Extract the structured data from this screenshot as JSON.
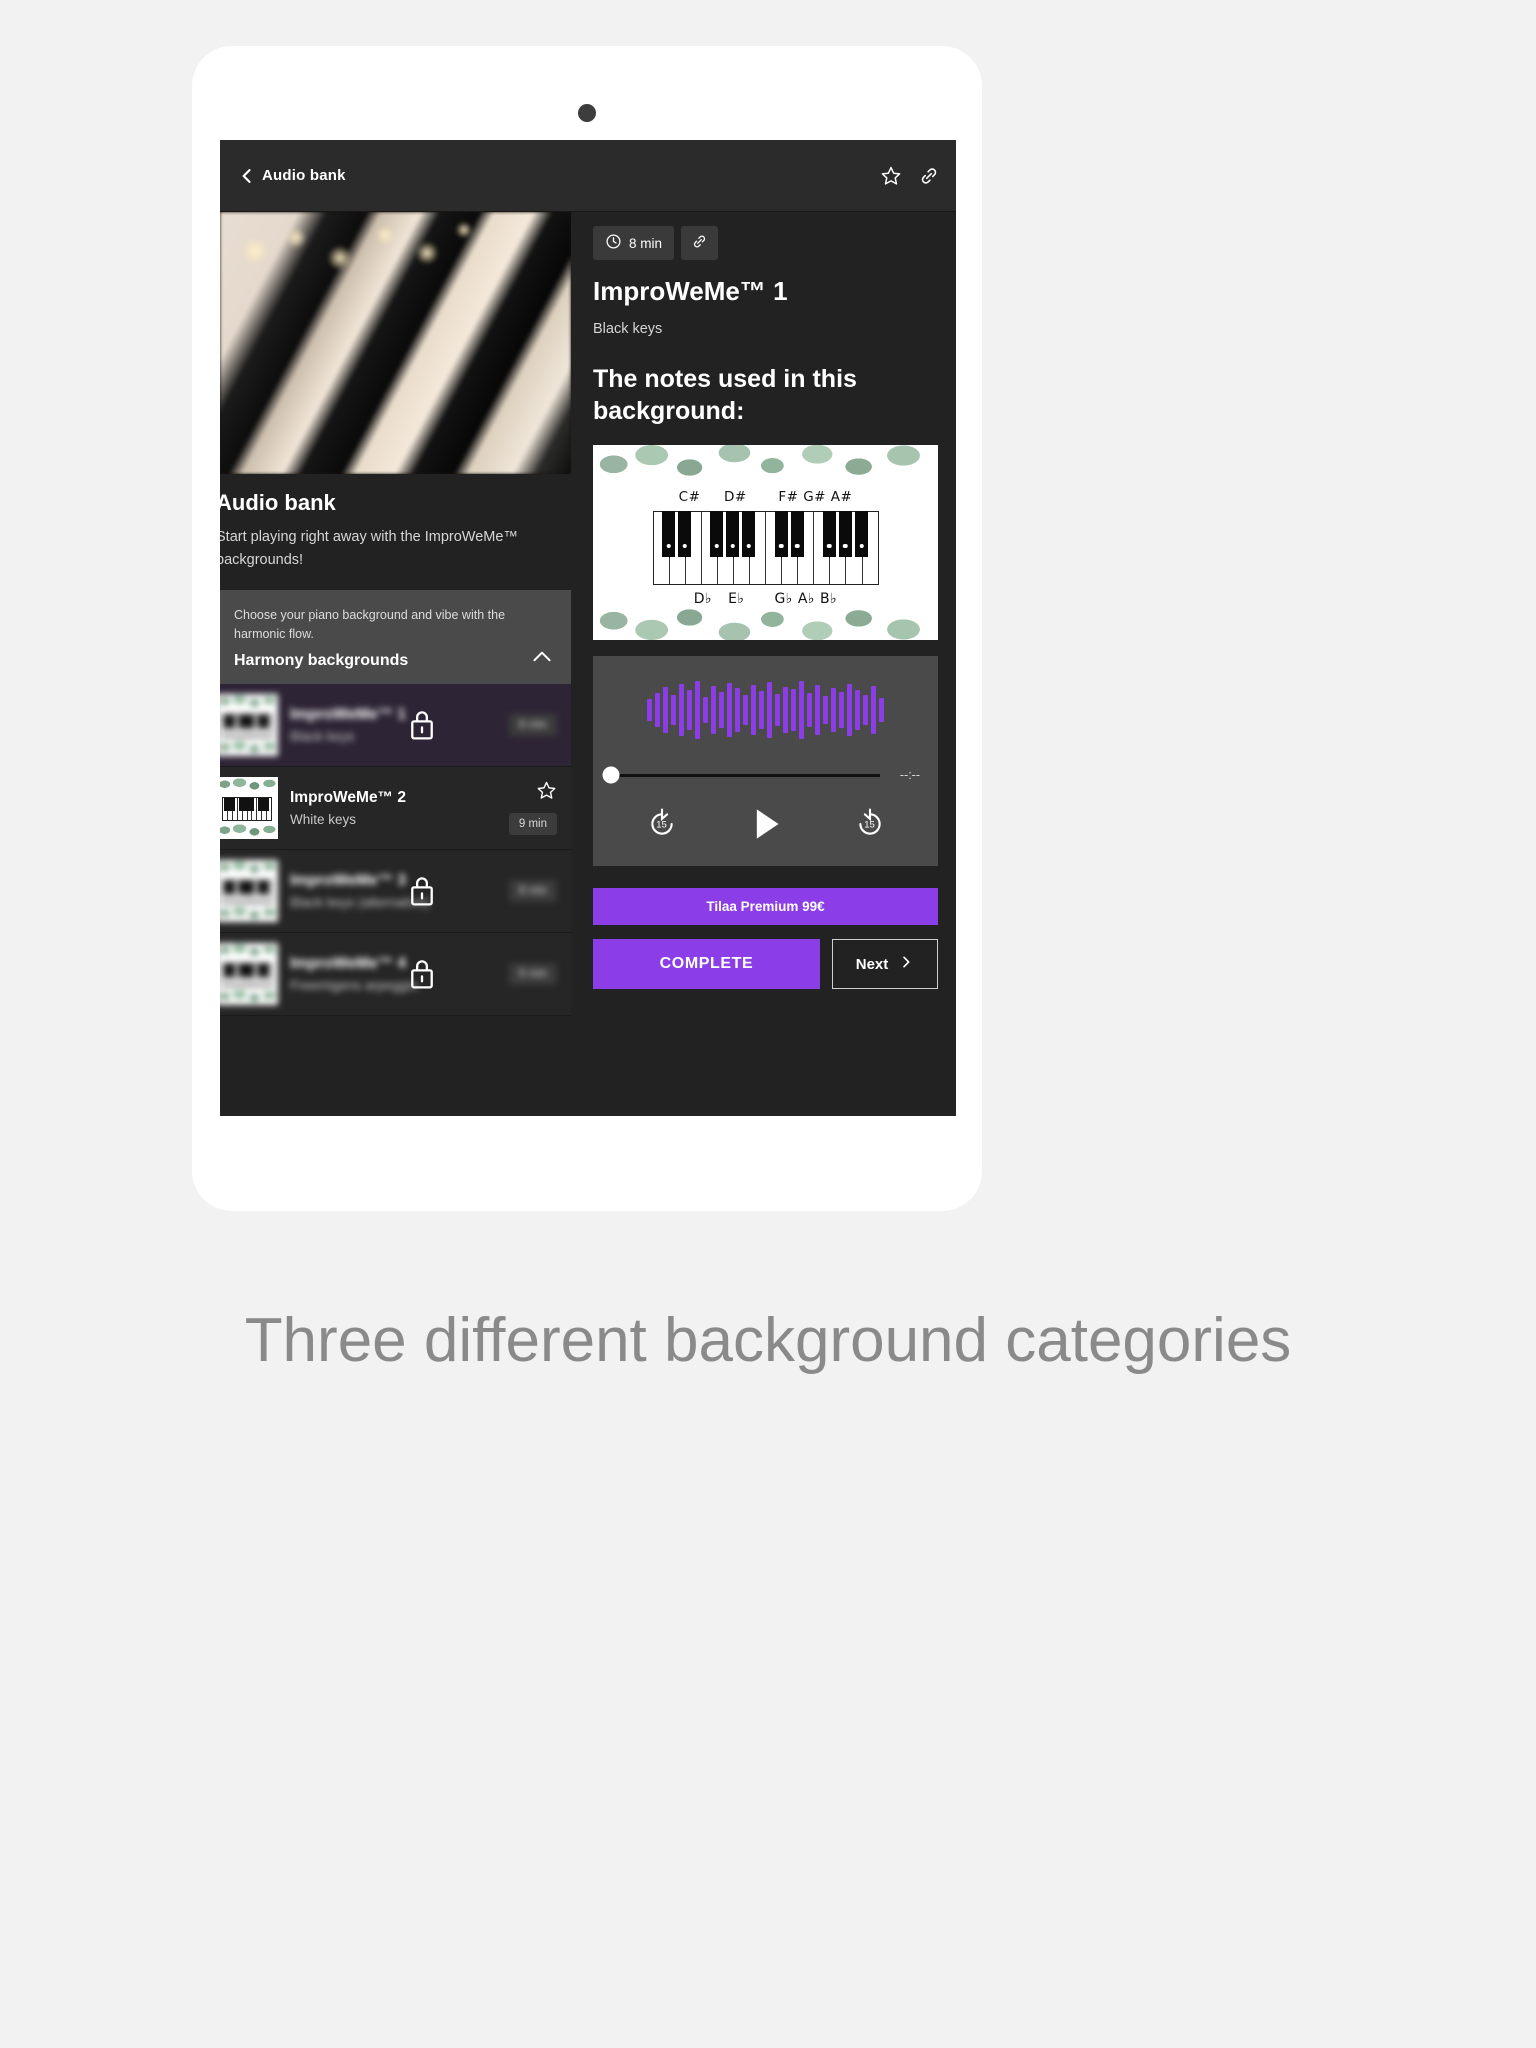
{
  "appbar": {
    "title": "Audio bank",
    "back_icon": "chevron-left-icon",
    "favorite_icon": "star-outline-icon",
    "link_icon": "link-icon"
  },
  "left_panel": {
    "hero_alt": "piano-keys-photo",
    "title": "Audio bank",
    "description": "Start playing right away with the ImproWeMe™ backgrounds!",
    "accordion": {
      "subtitle": "Choose your piano background and vibe with the harmonic flow.",
      "title": "Harmony backgrounds",
      "chevron_icon": "chevron-up-icon"
    },
    "tracks": [
      {
        "title": "ImproWeMe™ 1",
        "subtitle": "Black keys",
        "duration": "8 min",
        "locked": true,
        "selected": true,
        "lock_icon": "lock-icon"
      },
      {
        "title": "ImproWeMe™ 2",
        "subtitle": "White keys",
        "duration": "9 min",
        "locked": false,
        "selected": false,
        "favorite_icon": "star-outline-icon"
      },
      {
        "title": "ImproWeMe™ 3",
        "subtitle": "Black keys (alternative)",
        "duration": "8 min",
        "locked": true,
        "selected": false,
        "lock_icon": "lock-icon"
      },
      {
        "title": "ImproWeMe™ 4",
        "subtitle": "Freemigens arpeggio",
        "duration": "5 min",
        "locked": true,
        "selected": false,
        "lock_icon": "lock-icon"
      }
    ]
  },
  "right_panel": {
    "duration_chip": "8 min",
    "clock_icon": "clock-icon",
    "link_icon": "link-icon",
    "lesson_title": "ImproWeMe™ 1",
    "lesson_subtitle": "Black keys",
    "section_heading": "The notes used in this background:",
    "piano_diagram": {
      "sharp_labels": [
        "C#",
        "D#",
        "F#",
        "G#",
        "A#"
      ],
      "flat_labels": [
        "D♭",
        "E♭",
        "G♭",
        "A♭",
        "B♭"
      ]
    },
    "player": {
      "elapsed_label": "--:--",
      "rewind_seconds": "15",
      "forward_seconds": "15",
      "rewind_icon": "rewind-15-icon",
      "play_icon": "play-icon",
      "forward_icon": "forward-15-icon",
      "progress_percent": 0
    },
    "premium_button": "Tilaa Premium 99€",
    "complete_button": "COMPLETE",
    "next_button": "Next",
    "next_icon": "chevron-right-icon"
  },
  "page_caption": "Three different background categories",
  "colors": {
    "accent_purple": "#8B3DE8",
    "screen_bg": "#222222",
    "appbar_bg": "#2B2B2B",
    "card_bg": "#4A4A4A",
    "selected_track_bg": "#2D2435"
  },
  "waveform_bars": [
    22,
    34,
    46,
    30,
    52,
    40,
    58,
    26,
    48,
    36,
    54,
    44,
    30,
    50,
    38,
    56,
    32,
    46,
    42,
    58,
    34,
    50,
    28,
    44,
    36,
    52,
    40,
    30,
    48,
    24
  ],
  "thumb_keys": [
    0,
    1,
    0,
    1,
    0,
    0,
    1,
    0,
    1,
    0,
    1,
    0
  ]
}
